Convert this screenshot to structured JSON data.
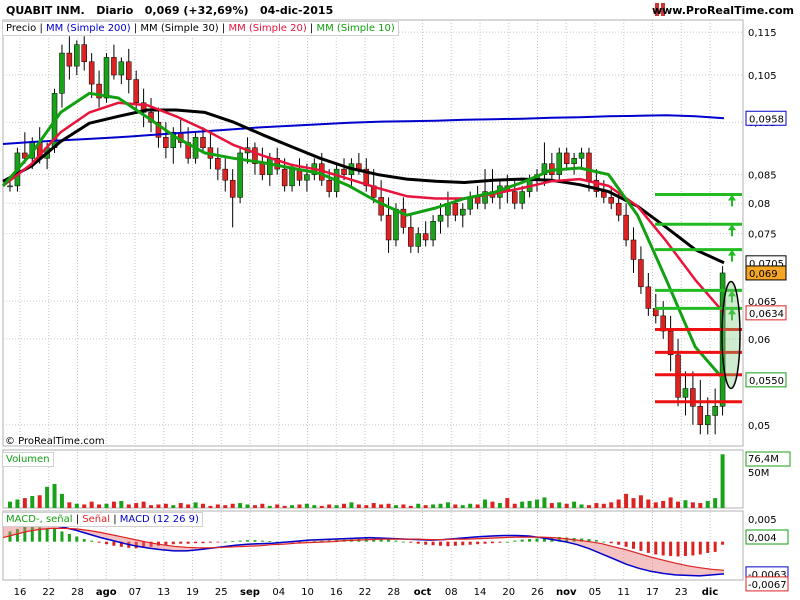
{
  "header": {
    "symbol": "QUABIT INM.",
    "period": "Diario",
    "last": "0,069 (+32,69%)",
    "date": "04-dic-2015",
    "site": "www.ProRealTime.com"
  },
  "copyright": "© ProRealTime.com",
  "legends": {
    "price": {
      "label": "Precio",
      "ma200": "MM (Simple 200)",
      "ma30": "MM (Simple 30)",
      "ma20": "MM (Simple 20)",
      "ma10": "MM (Simple 10)"
    },
    "volume": "Volumen",
    "macd": {
      "hist": "MACD-, señal",
      "signal": "Señal",
      "macd": "MACD (12 26 9)"
    }
  },
  "colors": {
    "up": "#1aa21a",
    "down": "#dd2222",
    "ma200": "#0000cc",
    "ma30": "#000000",
    "ma20": "#e8143c",
    "ma10": "#12a012",
    "grid": "#c8c8c8",
    "bg": "#ffffff",
    "target_green": "#22bb22",
    "target_red": "#ee1111"
  },
  "chart_data": {
    "type": "candlestick",
    "x_labels": [
      "16",
      "22",
      "28",
      "ago",
      "07",
      "13",
      "19",
      "25",
      "sep",
      "04",
      "10",
      "16",
      "22",
      "28",
      "oct",
      "08",
      "14",
      "20",
      "26",
      "nov",
      "05",
      "11",
      "17",
      "23",
      "dic"
    ],
    "price_axis": {
      "ticks": [
        "0,115",
        "0,105",
        "0,095",
        "0,085",
        "0,08",
        "0,075",
        "0,065",
        "0,06",
        "0,05"
      ],
      "tick_values": [
        0.115,
        0.105,
        0.095,
        0.085,
        0.08,
        0.075,
        0.065,
        0.06,
        0.05
      ],
      "tags": [
        {
          "text": "0,0958",
          "value": 0.0958,
          "color": "#0000cc",
          "bg": "#ffffff"
        },
        {
          "text": "0,0705",
          "value": 0.0705,
          "color": "#000000",
          "bg": "#ffffff"
        },
        {
          "text": "0,069",
          "value": 0.069,
          "color": "#000000",
          "bg": "#f5a623"
        },
        {
          "text": "0,0634",
          "value": 0.0634,
          "color": "#dd2222",
          "bg": "#ffffff"
        },
        {
          "text": "0,0550",
          "value": 0.055,
          "color": "#12a012",
          "bg": "#ffffff"
        }
      ],
      "scale": "log"
    },
    "candles": [
      [
        0.083,
        0.084,
        0.082,
        0.083
      ],
      [
        0.083,
        0.09,
        0.082,
        0.089
      ],
      [
        0.089,
        0.093,
        0.087,
        0.088
      ],
      [
        0.088,
        0.092,
        0.086,
        0.091
      ],
      [
        0.091,
        0.094,
        0.087,
        0.088
      ],
      [
        0.088,
        0.091,
        0.086,
        0.09
      ],
      [
        0.09,
        0.102,
        0.089,
        0.101
      ],
      [
        0.101,
        0.112,
        0.098,
        0.11
      ],
      [
        0.11,
        0.114,
        0.104,
        0.107
      ],
      [
        0.107,
        0.113,
        0.105,
        0.112
      ],
      [
        0.112,
        0.114,
        0.106,
        0.108
      ],
      [
        0.108,
        0.11,
        0.1,
        0.103
      ],
      [
        0.103,
        0.106,
        0.098,
        0.1
      ],
      [
        0.1,
        0.11,
        0.099,
        0.109
      ],
      [
        0.109,
        0.112,
        0.104,
        0.105
      ],
      [
        0.105,
        0.109,
        0.103,
        0.108
      ],
      [
        0.108,
        0.111,
        0.101,
        0.104
      ],
      [
        0.104,
        0.106,
        0.097,
        0.099
      ],
      [
        0.099,
        0.102,
        0.094,
        0.097
      ],
      [
        0.097,
        0.1,
        0.093,
        0.095
      ],
      [
        0.095,
        0.098,
        0.09,
        0.092
      ],
      [
        0.092,
        0.095,
        0.088,
        0.09
      ],
      [
        0.09,
        0.094,
        0.087,
        0.093
      ],
      [
        0.093,
        0.096,
        0.09,
        0.091
      ],
      [
        0.091,
        0.094,
        0.087,
        0.088
      ],
      [
        0.088,
        0.093,
        0.087,
        0.092
      ],
      [
        0.092,
        0.094,
        0.089,
        0.09
      ],
      [
        0.09,
        0.093,
        0.086,
        0.088
      ],
      [
        0.088,
        0.09,
        0.084,
        0.086
      ],
      [
        0.086,
        0.088,
        0.082,
        0.084
      ],
      [
        0.084,
        0.086,
        0.076,
        0.081
      ],
      [
        0.081,
        0.09,
        0.08,
        0.089
      ],
      [
        0.089,
        0.092,
        0.087,
        0.09
      ],
      [
        0.09,
        0.091,
        0.085,
        0.087
      ],
      [
        0.087,
        0.09,
        0.084,
        0.085
      ],
      [
        0.085,
        0.089,
        0.083,
        0.088
      ],
      [
        0.088,
        0.09,
        0.085,
        0.086
      ],
      [
        0.086,
        0.088,
        0.082,
        0.083
      ],
      [
        0.083,
        0.087,
        0.082,
        0.086
      ],
      [
        0.086,
        0.088,
        0.083,
        0.084
      ],
      [
        0.084,
        0.087,
        0.082,
        0.085
      ],
      [
        0.085,
        0.088,
        0.084,
        0.087
      ],
      [
        0.087,
        0.089,
        0.083,
        0.084
      ],
      [
        0.084,
        0.086,
        0.081,
        0.082
      ],
      [
        0.082,
        0.087,
        0.081,
        0.086
      ],
      [
        0.086,
        0.088,
        0.084,
        0.085
      ],
      [
        0.085,
        0.088,
        0.083,
        0.087
      ],
      [
        0.087,
        0.089,
        0.085,
        0.086
      ],
      [
        0.086,
        0.088,
        0.082,
        0.083
      ],
      [
        0.083,
        0.086,
        0.08,
        0.081
      ],
      [
        0.081,
        0.084,
        0.077,
        0.078
      ],
      [
        0.078,
        0.081,
        0.072,
        0.074
      ],
      [
        0.074,
        0.08,
        0.073,
        0.079
      ],
      [
        0.079,
        0.081,
        0.075,
        0.076
      ],
      [
        0.076,
        0.078,
        0.072,
        0.073
      ],
      [
        0.073,
        0.076,
        0.072,
        0.075
      ],
      [
        0.075,
        0.077,
        0.073,
        0.074
      ],
      [
        0.074,
        0.078,
        0.073,
        0.077
      ],
      [
        0.077,
        0.08,
        0.075,
        0.078
      ],
      [
        0.078,
        0.082,
        0.076,
        0.08
      ],
      [
        0.08,
        0.081,
        0.077,
        0.078
      ],
      [
        0.078,
        0.08,
        0.076,
        0.079
      ],
      [
        0.079,
        0.082,
        0.078,
        0.081
      ],
      [
        0.081,
        0.083,
        0.079,
        0.08
      ],
      [
        0.08,
        0.086,
        0.079,
        0.082
      ],
      [
        0.082,
        0.086,
        0.08,
        0.081
      ],
      [
        0.081,
        0.084,
        0.079,
        0.083
      ],
      [
        0.083,
        0.085,
        0.08,
        0.082
      ],
      [
        0.082,
        0.084,
        0.079,
        0.08
      ],
      [
        0.08,
        0.083,
        0.079,
        0.082
      ],
      [
        0.082,
        0.085,
        0.081,
        0.084
      ],
      [
        0.084,
        0.086,
        0.082,
        0.085
      ],
      [
        0.085,
        0.091,
        0.083,
        0.087
      ],
      [
        0.087,
        0.089,
        0.084,
        0.085
      ],
      [
        0.085,
        0.09,
        0.084,
        0.089
      ],
      [
        0.089,
        0.09,
        0.086,
        0.087
      ],
      [
        0.087,
        0.089,
        0.085,
        0.088
      ],
      [
        0.088,
        0.09,
        0.086,
        0.089
      ],
      [
        0.089,
        0.09,
        0.082,
        0.084
      ],
      [
        0.084,
        0.086,
        0.081,
        0.082
      ],
      [
        0.082,
        0.084,
        0.08,
        0.081
      ],
      [
        0.081,
        0.083,
        0.079,
        0.08
      ],
      [
        0.08,
        0.082,
        0.077,
        0.078
      ],
      [
        0.078,
        0.08,
        0.073,
        0.074
      ],
      [
        0.074,
        0.076,
        0.069,
        0.071
      ],
      [
        0.071,
        0.073,
        0.066,
        0.067
      ],
      [
        0.067,
        0.069,
        0.063,
        0.064
      ],
      [
        0.064,
        0.066,
        0.062,
        0.063
      ],
      [
        0.063,
        0.065,
        0.06,
        0.061
      ],
      [
        0.061,
        0.063,
        0.056,
        0.058
      ],
      [
        0.058,
        0.06,
        0.052,
        0.053
      ],
      [
        0.053,
        0.056,
        0.051,
        0.054
      ],
      [
        0.054,
        0.056,
        0.05,
        0.052
      ],
      [
        0.052,
        0.055,
        0.049,
        0.05
      ],
      [
        0.05,
        0.053,
        0.049,
        0.051
      ],
      [
        0.051,
        0.054,
        0.049,
        0.052
      ],
      [
        0.052,
        0.07,
        0.051,
        0.069
      ]
    ],
    "moving_averages": {
      "ma200": [
        0.0907,
        0.0911,
        0.0914,
        0.0917,
        0.092,
        0.0924,
        0.0928,
        0.0932,
        0.0936,
        0.094,
        0.0943,
        0.0946,
        0.0949,
        0.0951,
        0.0952,
        0.0953,
        0.0955,
        0.0956,
        0.0957,
        0.0959,
        0.096,
        0.0962,
        0.0963,
        0.0964,
        0.0962,
        0.0958
      ],
      "ma30": [
        0.0838,
        0.0866,
        0.0912,
        0.0948,
        0.0962,
        0.0975,
        0.0975,
        0.097,
        0.095,
        0.0925,
        0.0902,
        0.088,
        0.0862,
        0.085,
        0.0842,
        0.0838,
        0.0836,
        0.084,
        0.0842,
        0.084,
        0.0832,
        0.082,
        0.0795,
        0.076,
        0.0725,
        0.0705
      ],
      "ma20": [
        0.083,
        0.087,
        0.093,
        0.097,
        0.099,
        0.0985,
        0.0962,
        0.0935,
        0.0905,
        0.0885,
        0.0868,
        0.0858,
        0.0842,
        0.0826,
        0.0812,
        0.0808,
        0.0808,
        0.0816,
        0.0826,
        0.0838,
        0.0842,
        0.083,
        0.0795,
        0.0738,
        0.068,
        0.0634
      ],
      "ma10": [
        0.083,
        0.089,
        0.097,
        0.101,
        0.1,
        0.096,
        0.092,
        0.089,
        0.088,
        0.0872,
        0.0862,
        0.0852,
        0.083,
        0.0802,
        0.078,
        0.0792,
        0.0808,
        0.0818,
        0.0836,
        0.0858,
        0.0862,
        0.085,
        0.078,
        0.068,
        0.059,
        0.055
      ]
    },
    "targets": {
      "green": [
        0.0815,
        0.0765,
        0.0725,
        0.0665,
        0.064
      ],
      "red": [
        0.0612,
        0.0583,
        0.0556,
        0.0525
      ]
    },
    "volume_axis": {
      "ticks": [
        "76,4M",
        "50M"
      ],
      "max": 76.4
    },
    "volume": [
      9,
      12,
      14,
      17,
      18,
      30,
      34,
      20,
      8,
      6,
      5,
      9,
      5,
      6,
      9,
      10,
      5,
      7,
      9,
      4,
      5,
      6,
      4,
      7,
      5,
      8,
      6,
      3,
      5,
      4,
      6,
      7,
      5,
      4,
      6,
      3,
      5,
      3,
      4,
      5,
      6,
      4,
      3,
      5,
      4,
      6,
      8,
      5,
      4,
      7,
      5,
      6,
      4,
      5,
      3,
      6,
      4,
      5,
      6,
      8,
      5,
      4,
      6,
      5,
      12,
      9,
      7,
      14,
      6,
      9,
      10,
      12,
      15,
      7,
      8,
      6,
      9,
      5,
      4,
      7,
      6,
      8,
      12,
      20,
      14,
      18,
      12,
      8,
      10,
      15,
      9,
      11,
      8,
      7,
      10,
      14,
      76
    ],
    "macd_axis": {
      "ticks": [
        "0,005",
        "0,004",
        "-0,0063",
        "-0,0067"
      ],
      "tick_values": [
        0.005,
        0.004,
        -0.0063,
        -0.0067
      ],
      "range": [
        -0.0075,
        0.006
      ]
    },
    "macd_histogram": [
      0.002,
      0.0025,
      0.003,
      0.003,
      0.0028,
      0.0026,
      0.0025,
      0.002,
      0.0015,
      0.001,
      0.0005,
      0.0002,
      -0.0002,
      -0.0005,
      -0.0008,
      -0.001,
      -0.0012,
      -0.0013,
      -0.0012,
      -0.001,
      -0.0008,
      -0.0006,
      -0.0005,
      -0.0004,
      -0.0004,
      -0.0003,
      -0.0003,
      -0.0002,
      -0.0001,
      0.0,
      0.0001,
      0.0002,
      0.0003,
      0.0003,
      0.0002,
      0.0001,
      0.0,
      -0.0001,
      -0.0002,
      -0.0002,
      -0.0001,
      0.0001,
      0.0002,
      0.0003,
      0.0004,
      0.0004,
      0.0005,
      0.0006,
      0.0007,
      0.0006,
      0.0005,
      0.0004,
      0.0002,
      0.0,
      -0.0002,
      -0.0004,
      -0.0006,
      -0.0007,
      -0.0008,
      -0.0009,
      -0.0008,
      -0.0007,
      -0.0006,
      -0.0005,
      -0.0004,
      -0.0003,
      -0.0002,
      0.0,
      0.0002,
      0.0004,
      0.0005,
      0.0006,
      0.0007,
      0.0008,
      0.0009,
      0.0008,
      0.0007,
      0.0006,
      0.0005,
      0.0003,
      0.0,
      -0.0003,
      -0.0006,
      -0.001,
      -0.0014,
      -0.0018,
      -0.0022,
      -0.0025,
      -0.0027,
      -0.0028,
      -0.0029,
      -0.0028,
      -0.0027,
      -0.0025,
      -0.0022,
      -0.002,
      -0.0006
    ],
    "macd_line": [
      0.003,
      0.0034,
      0.0036,
      0.0035,
      0.0032,
      0.0028,
      0.0022,
      0.0015,
      0.0008,
      0.0002,
      -0.0004,
      -0.0009,
      -0.0013,
      -0.0016,
      -0.0018,
      -0.0018,
      -0.0016,
      -0.0013,
      -0.001,
      -0.0007,
      -0.0005,
      -0.0004,
      -0.0003,
      -0.0001,
      0.0001,
      0.0003,
      0.0004,
      0.0005,
      0.0006,
      0.0007,
      0.0008,
      0.0007,
      0.0006,
      0.0005,
      0.0004,
      0.0003,
      0.0004,
      0.0006,
      0.0008,
      0.001,
      0.0011,
      0.0012,
      0.0012,
      0.0011,
      0.0008,
      0.0004,
      0.0,
      -0.0006,
      -0.0014,
      -0.0024,
      -0.0034,
      -0.0044,
      -0.0052,
      -0.0058,
      -0.0062,
      -0.0065,
      -0.0066,
      -0.0067,
      -0.0065,
      -0.0063
    ],
    "signal_line": [
      0.0008,
      0.0014,
      0.002,
      0.0024,
      0.0026,
      0.0026,
      0.0025,
      0.0022,
      0.0018,
      0.0013,
      0.0008,
      0.0003,
      -0.0002,
      -0.0006,
      -0.0009,
      -0.0011,
      -0.0012,
      -0.0012,
      -0.0011,
      -0.001,
      -0.0009,
      -0.0008,
      -0.0006,
      -0.0005,
      -0.0003,
      -0.0002,
      -0.0001,
      0.0,
      0.0002,
      0.0003,
      0.0004,
      0.0005,
      0.0005,
      0.0005,
      0.0005,
      0.0004,
      0.0004,
      0.0005,
      0.0005,
      0.0006,
      0.0007,
      0.0008,
      0.0009,
      0.0009,
      0.0009,
      0.0008,
      0.0006,
      0.0003,
      0.0,
      -0.0004,
      -0.001,
      -0.0016,
      -0.0023,
      -0.003,
      -0.0036,
      -0.0042,
      -0.0047,
      -0.0051,
      -0.0054,
      -0.0056
    ]
  }
}
